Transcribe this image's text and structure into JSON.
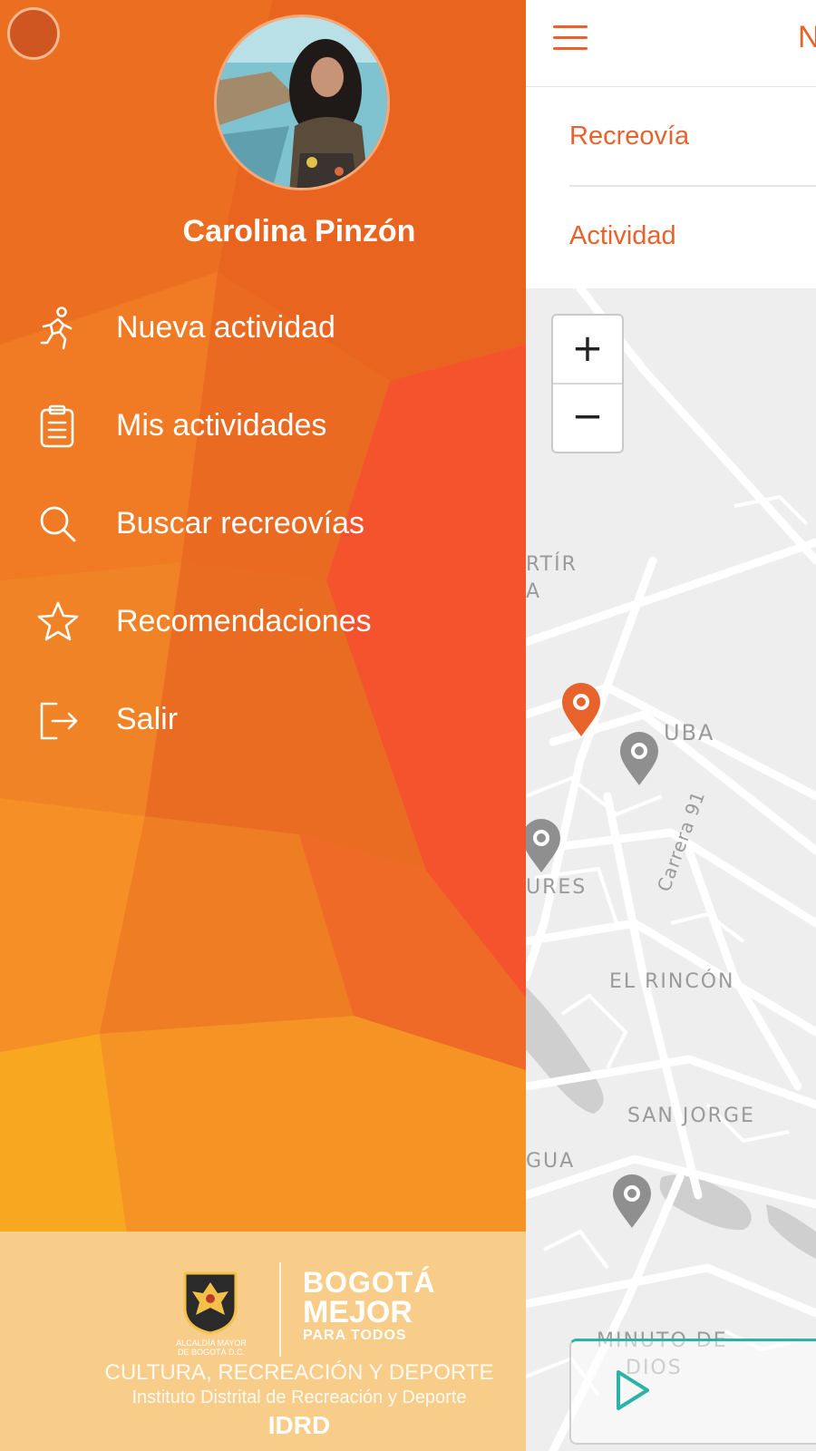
{
  "app": {
    "header_title": "N"
  },
  "filters": [
    {
      "label": "Recreovía"
    },
    {
      "label": "Actividad"
    }
  ],
  "map": {
    "zoom_in": "+",
    "zoom_out": "−",
    "labels": [
      "RTÍR",
      "A",
      "UBA",
      "URES",
      "Carrera 91",
      "EL RINCÓN",
      "SAN JORGE",
      "GUA",
      "MINUTO DE",
      "DIOS"
    ]
  },
  "drawer": {
    "user_name": "Carolina Pinzón",
    "menu": [
      {
        "label": "Nueva actividad",
        "icon": "runner-icon"
      },
      {
        "label": "Mis actividades",
        "icon": "clipboard-icon"
      },
      {
        "label": "Buscar recreovías",
        "icon": "search-icon"
      },
      {
        "label": "Recomendaciones",
        "icon": "star-icon"
      },
      {
        "label": "Salir",
        "icon": "logout-icon"
      }
    ],
    "footer": {
      "seal_caption_1": "ALCALDÍA MAYOR",
      "seal_caption_2": "DE BOGOTÁ D.C.",
      "bogota_line1": "BOGOTÁ",
      "bogota_line2": "MEJOR",
      "bogota_line3": "PARA TODOS",
      "institution_line1": "CULTURA, RECREACIÓN Y DEPORTE",
      "institution_line2": "Instituto Distrital de Recreación y Deporte",
      "institution_short": "IDRD"
    }
  },
  "colors": {
    "accent": "#e8622c",
    "drawer_orange": "#ee7422",
    "drawer_red": "#f4532e",
    "drawer_yellow": "#f8a721",
    "pin_active": "#e8622c",
    "pin_inactive": "#8f8f8f",
    "play_border": "#2bb3a7"
  }
}
